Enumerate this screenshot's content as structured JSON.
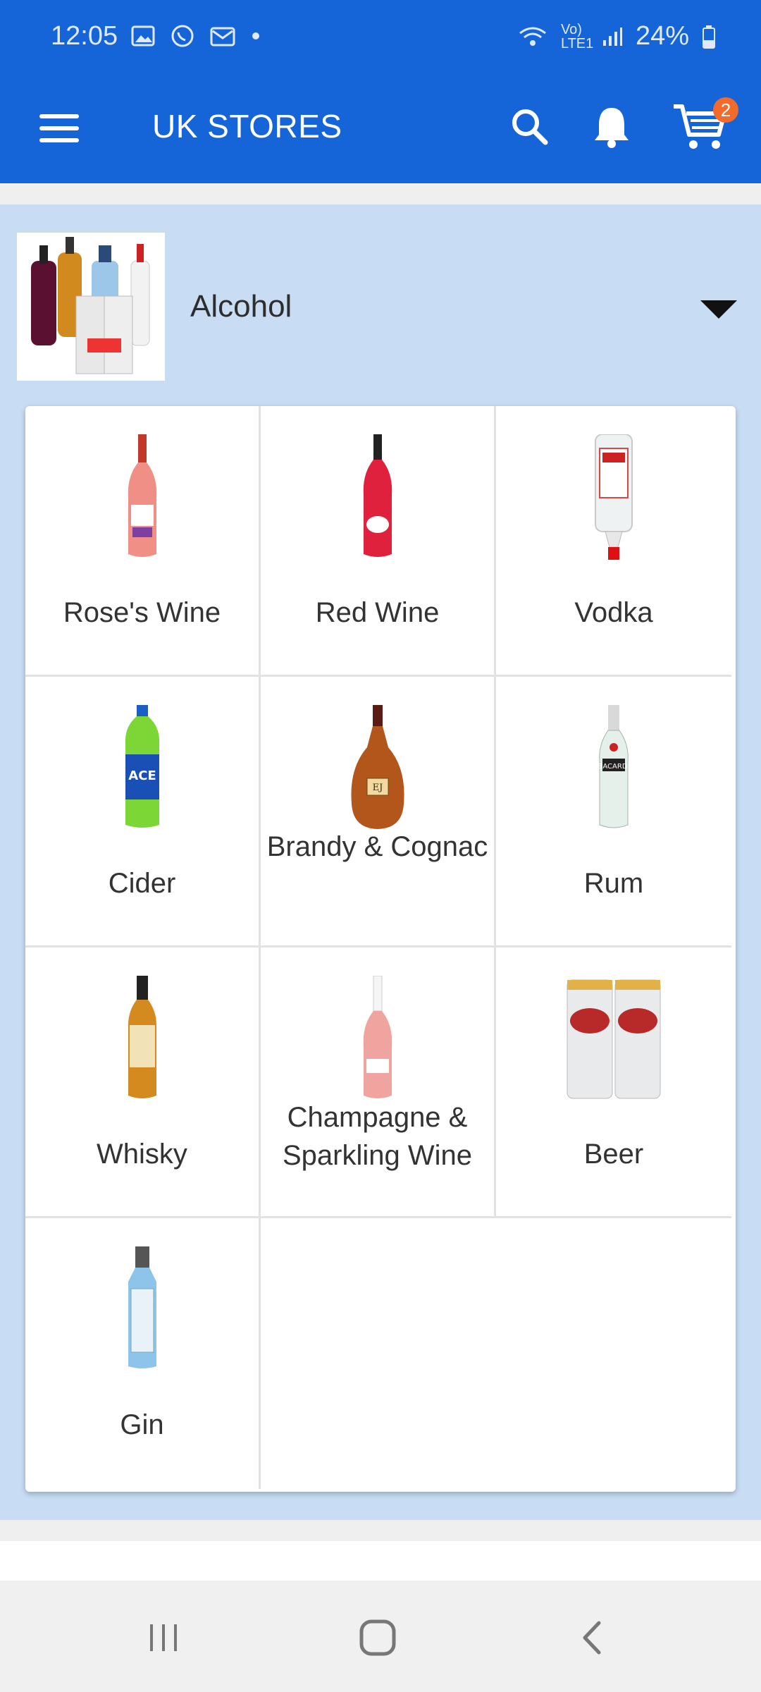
{
  "status_bar": {
    "time": "12:05",
    "network": "Vo) LTE1",
    "battery": "24%"
  },
  "app_bar": {
    "title": "UK STORES",
    "cart_count": "2"
  },
  "category": {
    "name": "Alcohol"
  },
  "subcategories": [
    {
      "label": "Rose's Wine"
    },
    {
      "label": "Red Wine"
    },
    {
      "label": "Vodka"
    },
    {
      "label": "Cider"
    },
    {
      "label": "Brandy & Cognac"
    },
    {
      "label": "Rum"
    },
    {
      "label": "Whisky"
    },
    {
      "label": "Champagne & Sparkling Wine"
    },
    {
      "label": "Beer"
    },
    {
      "label": "Gin"
    }
  ],
  "colors": {
    "primary": "#1565d8",
    "panel": "#c8dcf3",
    "badge": "#f26b2a"
  }
}
